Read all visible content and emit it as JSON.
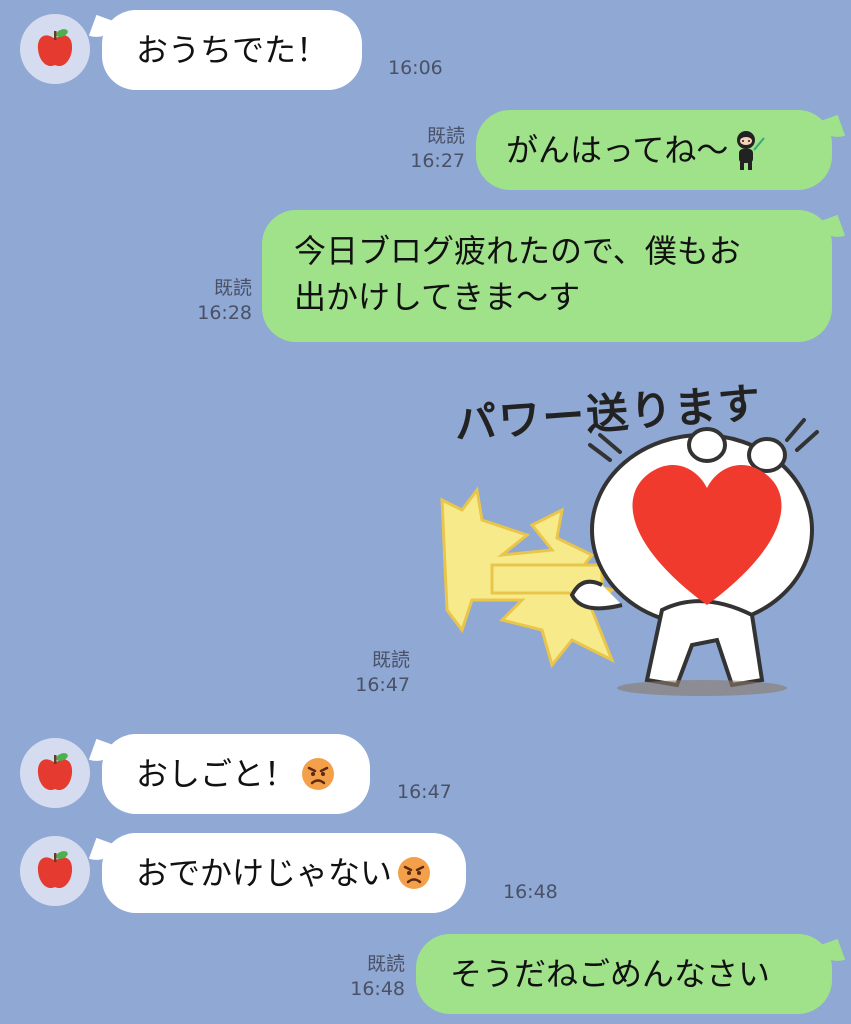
{
  "messages": [
    {
      "text": "おうちでた！",
      "time": "16:06"
    },
    {
      "text": "がんはってね〜",
      "read": "既読",
      "time": "16:27"
    },
    {
      "line1": "今日ブログ疲れたので、僕もお",
      "line2": "出かけしてきま〜す",
      "read": "既読",
      "time": "16:28"
    },
    {
      "sticker_text": "パワー送ります",
      "read": "既読",
      "time": "16:47"
    },
    {
      "text": "おしごと！",
      "time": "16:47"
    },
    {
      "text": "おでかけじゃない",
      "time": "16:48"
    },
    {
      "text": "そうだねごめんなさい",
      "read": "既読",
      "time": "16:48"
    }
  ],
  "colors": {
    "background": "#8fa8d4",
    "incoming": "#ffffff",
    "outgoing": "#9fe28a",
    "heart": "#f03a2e"
  },
  "icons": {
    "avatar": "apple-icon",
    "angry": "angry-face-icon"
  }
}
